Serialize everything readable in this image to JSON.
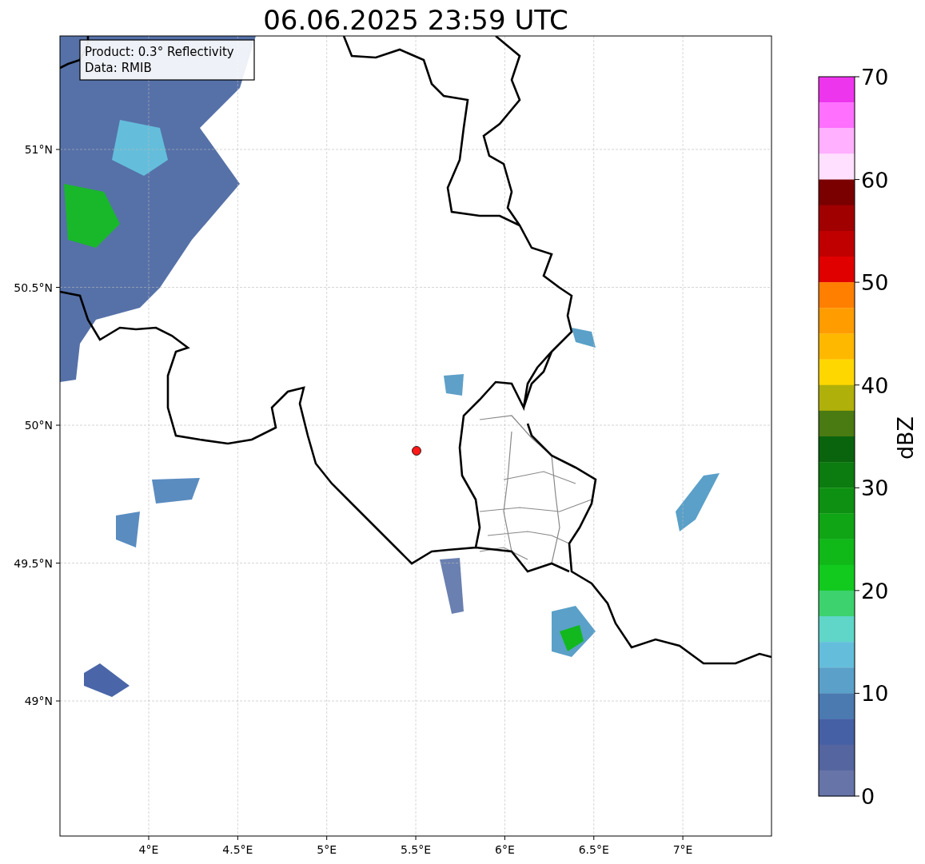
{
  "title": "06.06.2025 23:59 UTC",
  "legend": [
    "Product: 0.3° Reflectivity",
    "Data: RMIB"
  ],
  "map": {
    "xticks": [
      "4°E",
      "4.5°E",
      "5°E",
      "5.5°E",
      "6°E",
      "6.5°E",
      "7°E"
    ],
    "yticks": [
      "51°N",
      "50.5°N",
      "50°N",
      "49.5°N",
      "49°N"
    ]
  },
  "colorbar": {
    "label": "dBZ",
    "ticks": [
      "70",
      "60",
      "50",
      "40",
      "30",
      "20",
      "10",
      "0"
    ],
    "bins": [
      {
        "color": "#ee35ee"
      },
      {
        "color": "#ff70ff"
      },
      {
        "color": "#ffb0ff"
      },
      {
        "color": "#ffe0ff"
      },
      {
        "color": "#7a0000"
      },
      {
        "color": "#a00000"
      },
      {
        "color": "#c00000"
      },
      {
        "color": "#e00000"
      },
      {
        "color": "#ff7f00"
      },
      {
        "color": "#ff9c00"
      },
      {
        "color": "#ffb800"
      },
      {
        "color": "#ffd700"
      },
      {
        "color": "#b0b00a"
      },
      {
        "color": "#4a7a12"
      },
      {
        "color": "#0a640d"
      },
      {
        "color": "#0c7b10"
      },
      {
        "color": "#0e9012"
      },
      {
        "color": "#0fa515"
      },
      {
        "color": "#10b818"
      },
      {
        "color": "#12c91e"
      },
      {
        "color": "#3dd26e"
      },
      {
        "color": "#5fd6c8"
      },
      {
        "color": "#64bedb"
      },
      {
        "color": "#5aa0c8"
      },
      {
        "color": "#4a7ab0"
      },
      {
        "color": "#4660a5"
      },
      {
        "color": "#5465a0"
      },
      {
        "color": "#6674a8"
      }
    ]
  }
}
